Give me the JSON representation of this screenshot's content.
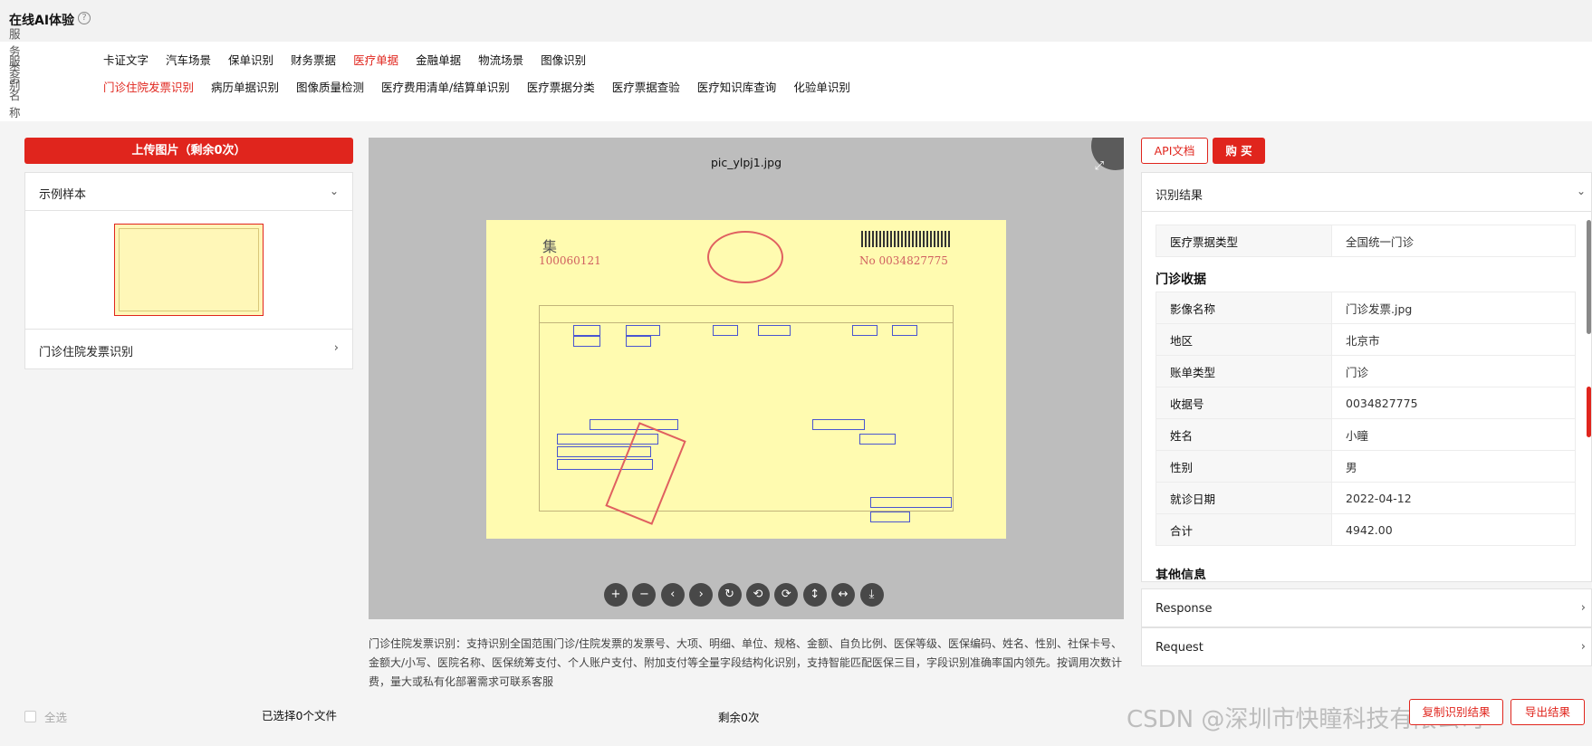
{
  "header": {
    "title": "在线AI体验",
    "help_icon": "?"
  },
  "service_category": {
    "label": "服务类别",
    "items": [
      "卡证文字",
      "汽车场景",
      "保单识别",
      "财务票据",
      "医疗单据",
      "金融单据",
      "物流场景",
      "图像识别"
    ],
    "active": "医疗单据"
  },
  "service_name": {
    "label": "服务名称",
    "items": [
      "门诊住院发票识别",
      "病历单据识别",
      "图像质量检测",
      "医疗费用清单/结算单识别",
      "医疗票据分类",
      "医疗票据查验",
      "医疗知识库查询",
      "化验单识别"
    ],
    "active": "门诊住院发票识别"
  },
  "left": {
    "upload_label": "上传图片（剩余0次）",
    "sample_title": "示例样本",
    "sample_item": "门诊住院发票识别"
  },
  "viewer": {
    "file_name": "pic_ylpj1.jpg",
    "receipt": {
      "mark": "集",
      "number_left": "100060121",
      "number_right": "No 0034827775"
    },
    "tools": [
      "+",
      "−",
      "‹",
      "›",
      "↻",
      "⟲",
      "⟳",
      "↕",
      "↔",
      "⤓"
    ]
  },
  "description": "门诊住院发票识别：支持识别全国范围门诊/住院发票的发票号、大项、明细、单位、规格、金额、自负比例、医保等级、医保编码、姓名、性别、社保卡号、金额大/小写、医院名称、医保统筹支付、个人账户支付、附加支付等全量字段结构化识别，支持智能匹配医保三目，字段识别准确率国内领先。按调用次数计费，量大或私有化部署需求可联系客服",
  "footer": {
    "select_all": "全选",
    "selected_count": "已选择0个文件",
    "remaining": "剩余0次",
    "copy_button": "复制识别结果",
    "export_button": "导出结果"
  },
  "right": {
    "api_button": "API文档",
    "buy_button": "购 买",
    "result_title": "识别结果",
    "type_row": {
      "key": "医疗票据类型",
      "value": "全国统一门诊"
    },
    "section_receipt": "门诊收据",
    "fields": [
      {
        "key": "影像名称",
        "value": "门诊发票.jpg"
      },
      {
        "key": "地区",
        "value": "北京市"
      },
      {
        "key": "账单类型",
        "value": "门诊"
      },
      {
        "key": "收据号",
        "value": "0034827775"
      },
      {
        "key": "姓名",
        "value": "小瞳"
      },
      {
        "key": "性别",
        "value": "男"
      },
      {
        "key": "就诊日期",
        "value": "2022-04-12"
      },
      {
        "key": "合计",
        "value": "4942.00"
      }
    ],
    "section_other": "其他信息",
    "response_label": "Response",
    "request_label": "Request"
  },
  "watermark": "CSDN @深圳市快瞳科技有限公司",
  "colors": {
    "accent": "#e0251d"
  }
}
